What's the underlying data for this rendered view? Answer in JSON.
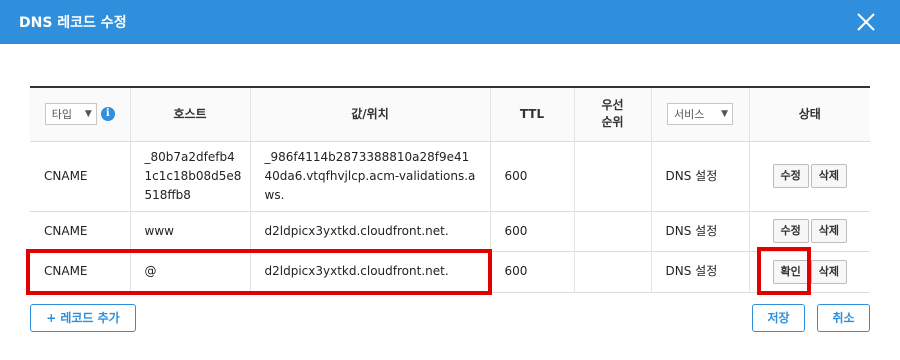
{
  "dialog": {
    "title": "DNS 레코드 수정",
    "close_icon": "close-icon"
  },
  "table": {
    "headers": {
      "type_select": "타입",
      "host": "호스트",
      "value": "값/위치",
      "ttl": "TTL",
      "priority_line1": "우선",
      "priority_line2": "순위",
      "service_select": "서비스",
      "status": "상태"
    },
    "rows": [
      {
        "type": "CNAME",
        "host": "_80b7a2dfefb41c1c18b08d5e8518ffb8",
        "value": "_986f4114b2873388810a28f9e4140da6.vtqfhvjlcp.acm-validations.aws.",
        "ttl": "600",
        "priority": "",
        "service": "DNS 설정",
        "edit_label": "수정",
        "delete_label": "삭제"
      },
      {
        "type": "CNAME",
        "host": "www",
        "value": "d2ldpicx3yxtkd.cloudfront.net.",
        "ttl": "600",
        "priority": "",
        "service": "DNS 설정",
        "edit_label": "수정",
        "delete_label": "삭제"
      },
      {
        "type": "CNAME",
        "host": "@",
        "value": "d2ldpicx3yxtkd.cloudfront.net.",
        "ttl": "600",
        "priority": "",
        "service": "DNS 설정",
        "confirm_label": "확인",
        "delete_label": "삭제"
      }
    ]
  },
  "footer": {
    "add_record_label": "레코드 추가",
    "add_symbol": "+",
    "save_label": "저장",
    "cancel_label": "취소"
  },
  "colors": {
    "accent": "#2f8fdd",
    "highlight": "#e30000"
  }
}
